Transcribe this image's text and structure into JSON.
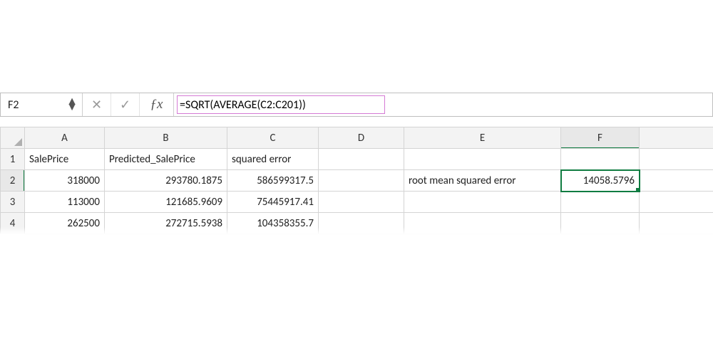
{
  "name_box": {
    "value": "F2"
  },
  "formula_bar": {
    "formula": "=SQRT(AVERAGE(C2:C201))"
  },
  "columns": [
    "A",
    "B",
    "C",
    "D",
    "E",
    "F"
  ],
  "rows": {
    "1": {
      "A": "SalePrice",
      "B": "Predicted_SalePrice",
      "C": "squared error",
      "D": "",
      "E": "",
      "F": ""
    },
    "2": {
      "A": "318000",
      "B": "293780.1875",
      "C": "586599317.5",
      "D": "",
      "E": "root mean squared error",
      "F": "14058.5796"
    },
    "3": {
      "A": "113000",
      "B": "121685.9609",
      "C": "75445917.41",
      "D": "",
      "E": "",
      "F": ""
    },
    "4": {
      "A": "262500",
      "B": "272715.5938",
      "C": "104358355.7",
      "D": "",
      "E": "",
      "F": ""
    }
  },
  "active_cell": "F2"
}
